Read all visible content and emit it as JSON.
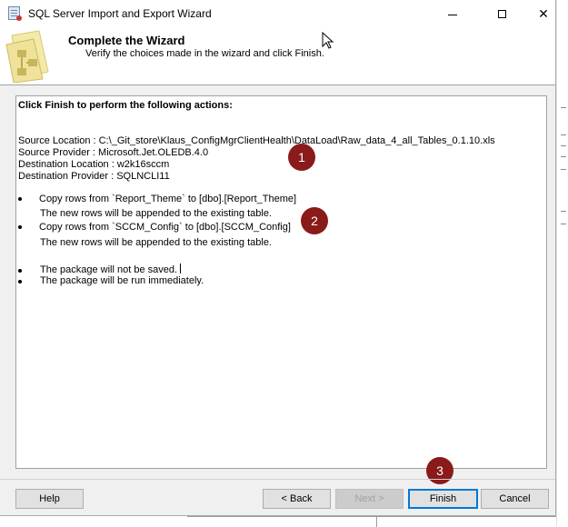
{
  "window": {
    "title": "SQL Server Import and Export Wizard",
    "controls": {
      "minimize": "minimize",
      "maximize": "maximize",
      "close": "✕"
    }
  },
  "header": {
    "title": "Complete the Wizard",
    "subtitle": "Verify the choices made in the wizard and click Finish."
  },
  "content": {
    "lead": "Click Finish to perform the following actions:",
    "details": [
      "Source Location : C:\\_Git_store\\Klaus_ConfigMgrClientHealth\\DataLoad\\Raw_data_4_all_Tables_0.1.10.xls",
      "Source Provider : Microsoft.Jet.OLEDB.4.0",
      "Destination Location : w2k16sccm",
      "Destination Provider : SQLNCLI11"
    ],
    "actions": [
      {
        "text": "Copy rows from `Report_Theme` to [dbo].[Report_Theme]",
        "note": "The new rows will be appended to the existing table."
      },
      {
        "text": "Copy rows from `SCCM_Config` to [dbo].[SCCM_Config]",
        "note": "The new rows will be appended to the existing table."
      }
    ],
    "package": [
      "The package will not be saved.",
      "The package will be run immediately."
    ]
  },
  "markers": [
    "1",
    "2",
    "3"
  ],
  "buttons": {
    "help": "Help",
    "back": "< Back",
    "next": "Next >",
    "finish": "Finish",
    "cancel": "Cancel"
  },
  "colors": {
    "marker": "#8b1a1a",
    "default_button_border": "#0078d7"
  }
}
